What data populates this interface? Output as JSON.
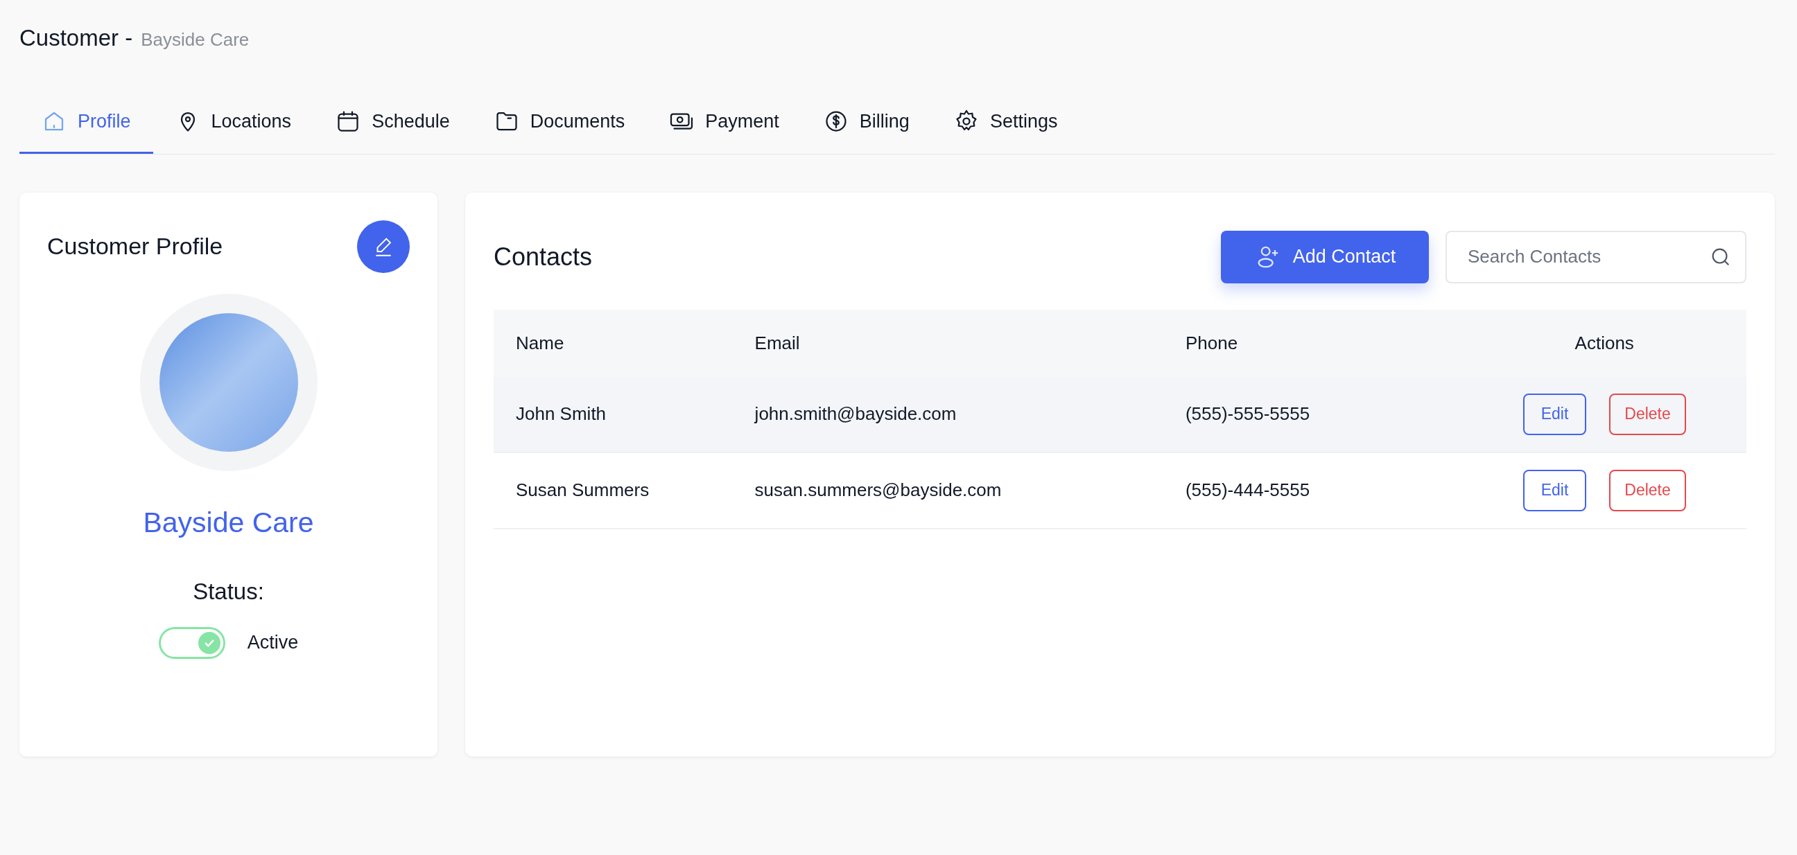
{
  "header": {
    "title": "Customer -",
    "subtitle": "Bayside Care"
  },
  "tabs": [
    {
      "label": "Profile",
      "kind": "home",
      "selected": true
    },
    {
      "label": "Locations",
      "kind": "pin",
      "selected": false
    },
    {
      "label": "Schedule",
      "kind": "calendar",
      "selected": false
    },
    {
      "label": "Documents",
      "kind": "folder",
      "selected": false
    },
    {
      "label": "Payment",
      "kind": "money",
      "selected": false
    },
    {
      "label": "Billing",
      "kind": "dollar",
      "selected": false
    },
    {
      "label": "Settings",
      "kind": "gear",
      "selected": false
    }
  ],
  "profile": {
    "title": "Customer Profile",
    "name": "Bayside Care",
    "status_label": "Status:",
    "status_on": true,
    "status_text": "Active"
  },
  "contacts": {
    "title": "Contacts",
    "add_button": "Add Contact",
    "search": {
      "placeholder": "Search Contacts"
    },
    "columns": [
      "Name",
      "Email",
      "Phone",
      "Actions"
    ],
    "rows": [
      {
        "name": "John Smith",
        "email": "john.smith@bayside.com",
        "phone": "(555)-555-5555",
        "edit": "Edit",
        "delete": "Delete",
        "highlighted": true
      },
      {
        "name": "Susan Summers",
        "email": "susan.summers@bayside.com",
        "phone": "(555)-444-5555",
        "edit": "Edit",
        "delete": "Delete",
        "highlighted": false
      }
    ]
  }
}
